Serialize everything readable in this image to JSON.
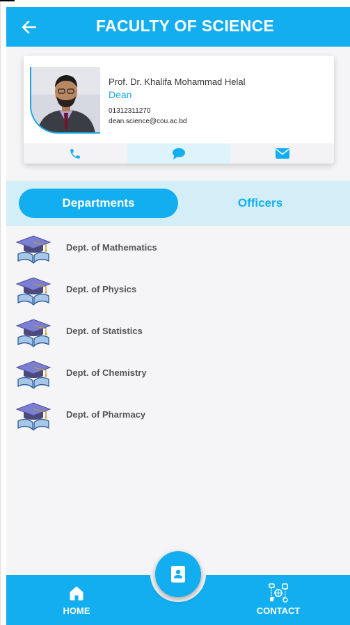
{
  "appbar": {
    "title": "FACULTY OF SCIENCE",
    "back_icon": "arrow-left-icon"
  },
  "dean": {
    "name": "Prof. Dr. Khalifa Mohammad Helal",
    "title": "Dean",
    "phone": "01312311270",
    "email": "dean.science@cou.ac.bd",
    "actions": [
      {
        "icon": "phone-icon",
        "active": false
      },
      {
        "icon": "chat-icon",
        "active": true
      },
      {
        "icon": "mail-icon",
        "active": false
      }
    ]
  },
  "tabs": {
    "departments": "Departments",
    "officers": "Officers",
    "selected": "departments"
  },
  "departments": [
    {
      "label": "Dept. of Mathematics",
      "icon": "graduation-book-icon"
    },
    {
      "label": "Dept. of Physics",
      "icon": "graduation-book-icon"
    },
    {
      "label": "Dept. of Statistics",
      "icon": "graduation-book-icon"
    },
    {
      "label": "Dept. of Chemistry",
      "icon": "graduation-book-icon"
    },
    {
      "label": "Dept. of Pharmacy",
      "icon": "graduation-book-icon"
    }
  ],
  "bottom_nav": {
    "home": "HOME",
    "contact": "CONTACT",
    "fab_icon": "contact-book-icon"
  },
  "colors": {
    "primary": "#12aef0",
    "tab_bar": "#d4eef8",
    "list_background": "#f5f5f7"
  }
}
